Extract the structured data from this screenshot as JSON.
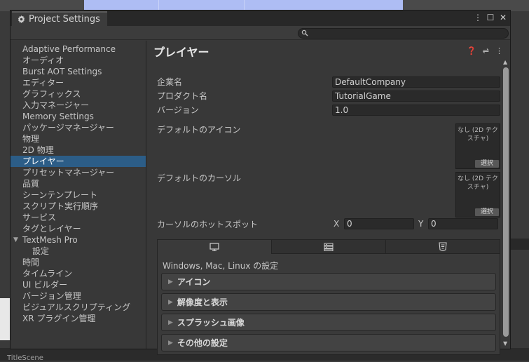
{
  "window": {
    "tab_label": "Project Settings",
    "controls": {
      "menu": "⋮",
      "maximize": "☐",
      "close": "✕"
    },
    "search": {
      "placeholder": "",
      "icon": "search-icon"
    }
  },
  "sidebar": {
    "items": [
      {
        "label": "Adaptive Performance"
      },
      {
        "label": "オーディオ"
      },
      {
        "label": "Burst AOT Settings"
      },
      {
        "label": "エディター"
      },
      {
        "label": "グラフィックス"
      },
      {
        "label": "入力マネージャー"
      },
      {
        "label": "Memory Settings"
      },
      {
        "label": "パッケージマネージャー"
      },
      {
        "label": "物理"
      },
      {
        "label": "2D 物理"
      },
      {
        "label": "プレイヤー",
        "selected": true
      },
      {
        "label": "プリセットマネージャー"
      },
      {
        "label": "品質"
      },
      {
        "label": "シーンテンプレート"
      },
      {
        "label": "スクリプト実行順序"
      },
      {
        "label": "サービス"
      },
      {
        "label": "タグとレイヤー"
      },
      {
        "label": "TextMesh Pro",
        "expanded": true
      },
      {
        "label": "設定",
        "child": true
      },
      {
        "label": "時間"
      },
      {
        "label": "タイムライン"
      },
      {
        "label": "UI ビルダー"
      },
      {
        "label": "バージョン管理"
      },
      {
        "label": "ビジュアルスクリプティング"
      },
      {
        "label": "XR プラグイン管理"
      }
    ]
  },
  "main": {
    "title": "プレイヤー",
    "header_icons": [
      "help-icon",
      "preset-icon",
      "more-menu-icon"
    ],
    "company_name": {
      "label": "企業名",
      "value": "DefaultCompany"
    },
    "product_name": {
      "label": "プロダクト名",
      "value": "TutorialGame"
    },
    "version": {
      "label": "バージョン",
      "value": "1.0"
    },
    "default_icon": {
      "label": "デフォルトのアイコン",
      "preview_text": "なし (2D テクスチャ)",
      "select_label": "選択"
    },
    "default_cursor": {
      "label": "デフォルトのカーソル",
      "preview_text": "なし (2D テクスチャ)",
      "select_label": "選択"
    },
    "cursor_hotspot": {
      "label": "カーソルのホットスポット",
      "x_label": "X",
      "x_value": "0",
      "y_label": "Y",
      "y_value": "0"
    },
    "platform": {
      "tabs": [
        {
          "icon": "monitor-icon",
          "active": true
        },
        {
          "icon": "server-icon"
        },
        {
          "icon": "html5-icon"
        }
      ],
      "title": "Windows, Mac, Linux の設定",
      "sections": [
        {
          "label": "アイコン"
        },
        {
          "label": "解像度と表示"
        },
        {
          "label": "スプラッシュ画像"
        },
        {
          "label": "その他の設定"
        }
      ]
    }
  },
  "background": {
    "scene_label": "TitleScene"
  },
  "colors": {
    "selection": "#2c5d87",
    "window_bg": "#383838",
    "titlebar": "#282828"
  }
}
